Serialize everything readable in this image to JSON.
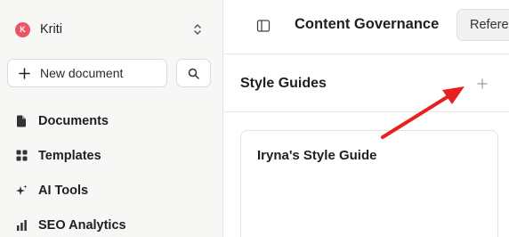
{
  "sidebar": {
    "workspace": {
      "initial": "K",
      "name": "Kriti",
      "avatar_color": "#ea5565"
    },
    "new_document_label": "New document",
    "items": [
      {
        "label": "Documents",
        "icon": "document-icon"
      },
      {
        "label": "Templates",
        "icon": "grid-icon"
      },
      {
        "label": "AI Tools",
        "icon": "sparkle-icon"
      },
      {
        "label": "SEO Analytics",
        "icon": "bar-chart-icon"
      }
    ]
  },
  "header": {
    "title": "Content Governance",
    "tab_label": "Refere"
  },
  "section": {
    "title": "Style Guides",
    "guides": [
      {
        "name": "Iryna's Style Guide"
      }
    ]
  },
  "annotation": {
    "arrow_color": "#e8211f"
  }
}
